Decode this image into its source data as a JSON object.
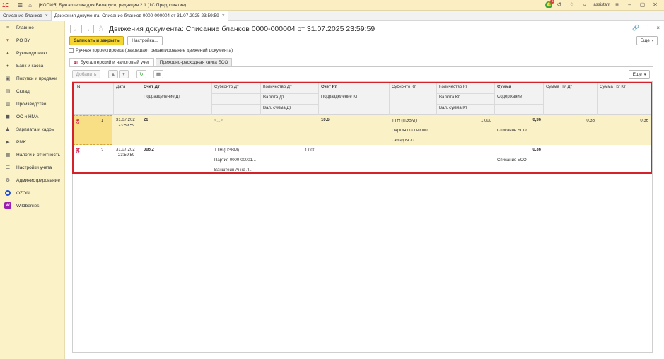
{
  "titlebar": {
    "logo": "1С",
    "app_title": "[КОПИЯ] Бухгалтерия для Беларуси, редакция 2.1  (1С:Предприятие)",
    "notification_count": "5",
    "user": "assistant"
  },
  "tabs": [
    {
      "label": "Списание бланков"
    },
    {
      "label": "Движения документа: Списание бланков 0000-000004 от 31.07.2025 23:59:59"
    }
  ],
  "sidebar": {
    "items": [
      {
        "label": "Главное",
        "icon": "menu-icon"
      },
      {
        "label": "PO BY",
        "icon": "heart-icon"
      },
      {
        "label": "Руководителю",
        "icon": "chart-icon"
      },
      {
        "label": "Банк и касса",
        "icon": "bank-icon"
      },
      {
        "label": "Покупки и продажи",
        "icon": "cart-icon"
      },
      {
        "label": "Склад",
        "icon": "warehouse-icon"
      },
      {
        "label": "Производство",
        "icon": "factory-icon"
      },
      {
        "label": "ОС и НМА",
        "icon": "truck-icon"
      },
      {
        "label": "Зарплата и кадры",
        "icon": "people-icon"
      },
      {
        "label": "PMK",
        "icon": "pmk-icon"
      },
      {
        "label": "Налоги и отчетность",
        "icon": "tax-icon"
      },
      {
        "label": "Настройки учета",
        "icon": "settings-list-icon"
      },
      {
        "label": "Администрирование",
        "icon": "gear-icon"
      },
      {
        "label": "OZON",
        "icon": "ozon-icon"
      },
      {
        "label": "Wildberries",
        "icon": "wildberries-icon"
      }
    ]
  },
  "main": {
    "title": "Движения документа: Списание бланков 0000-000004 от 31.07.2025 23:59:59",
    "save_close": "Записать и закрыть",
    "settings": "Настройка...",
    "more": "Еще",
    "manual_correction": "Ручная корректировка (разрешает редактирование движений документа)",
    "subtabs": [
      "Бухгалтерский и налоговый учет",
      "Приходно-расходная книга БСО"
    ],
    "add": "Добавить",
    "table_more": "Еще"
  },
  "table": {
    "headers": {
      "n": "N",
      "date": "Дата",
      "schet_dt": "Счет Дт",
      "podr_dt": "Подразделение Дт",
      "subkonto_dt": "Субконто Дт",
      "kol_dt": "Количество Дт",
      "val_dt": "Валюта Дт",
      "valsum_dt": "Вал. сумма Дт",
      "schet_kt": "Счет Кт",
      "podr_kt": "Подразделение Кт",
      "subkonto_kt": "Субконто Кт",
      "kol_kt": "Количество Кт",
      "val_kt": "Валюта Кт",
      "valsum_kt": "Вал. сумма Кт",
      "summa": "Сумма",
      "soderzhanie": "Содержание",
      "summa_nu_dt": "Сумма НУ Дт",
      "summa_nu_kt": "Сумма НУ Кт"
    },
    "rows": [
      {
        "n": "1",
        "date": "31.07.202",
        "time": "23:59:59",
        "schet_dt": "26",
        "subkonto_dt": "<...>",
        "kol_dt": "",
        "schet_kt": "10.6",
        "subkonto_kt_1": "ТТН (ПЭВМ)",
        "subkonto_kt_2": "Партия 0000-0000...",
        "subkonto_kt_3": "Склад БСО",
        "kol_kt": "1,000",
        "summa": "0,36",
        "soderzhanie": "Списание БСО",
        "summa_nu_dt": "0,36",
        "summa_nu_kt": "0,36"
      },
      {
        "n": "2",
        "date": "31.07.202",
        "time": "23:59:59",
        "schet_dt": "006.2",
        "subkonto_dt_1": "ТТН (ПЭВМ)",
        "subkonto_dt_2": "Партия 0000-00001...",
        "subkonto_dt_3": "Ванштейн Анна Л...",
        "kol_dt": "1,000",
        "summa": "0,36",
        "soderzhanie": "Списание БСО"
      }
    ],
    "row_icon": "ДТ КТ"
  }
}
